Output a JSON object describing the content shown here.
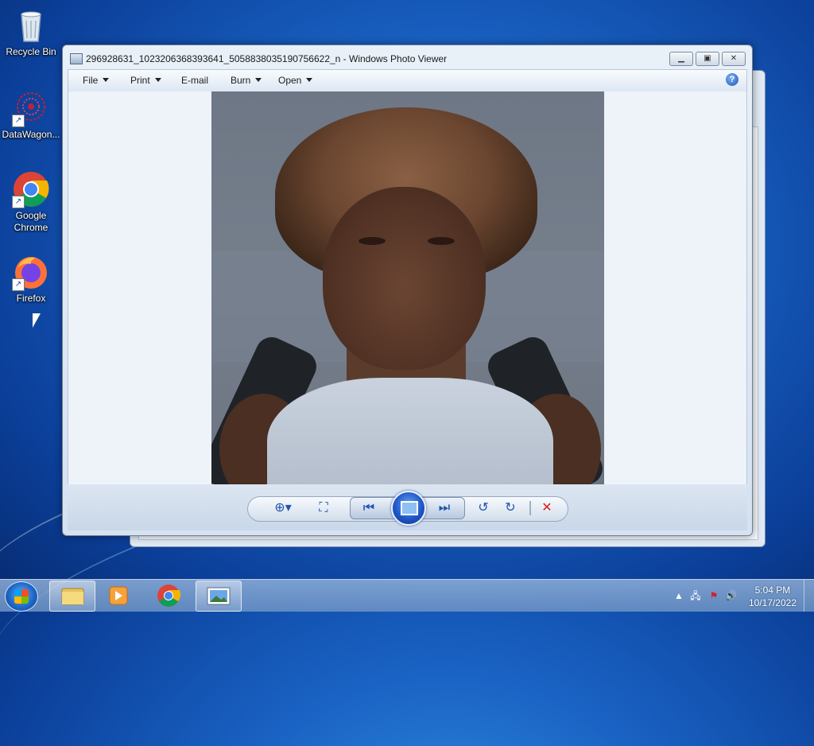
{
  "desktop": {
    "icons": [
      {
        "label": "Recycle Bin"
      },
      {
        "label": "DataWagon..."
      },
      {
        "label": "Google Chrome"
      },
      {
        "label": "Firefox"
      }
    ]
  },
  "window": {
    "title": "296928631_1023206368393641_5058838035190756622_n - Windows Photo Viewer",
    "menu": {
      "file": "File",
      "print": "Print",
      "email": "E-mail",
      "burn": "Burn",
      "open": "Open"
    },
    "help_glyph": "?",
    "photo": {
      "description_icon": "portrait-photo"
    }
  },
  "controls": {
    "zoom_icon": "zoom-icon",
    "fit_icon": "actual-size-icon",
    "prev_icon": "previous-icon",
    "slideshow_icon": "slideshow-icon",
    "next_icon": "next-icon",
    "rotate_ccw_icon": "rotate-counterclockwise-icon",
    "rotate_cw_icon": "rotate-clockwise-icon",
    "delete_icon": "delete-icon",
    "delete_color": "#d42020"
  },
  "taskbar": {
    "clock_time": "5:04 PM",
    "clock_date": "10/17/2022"
  }
}
